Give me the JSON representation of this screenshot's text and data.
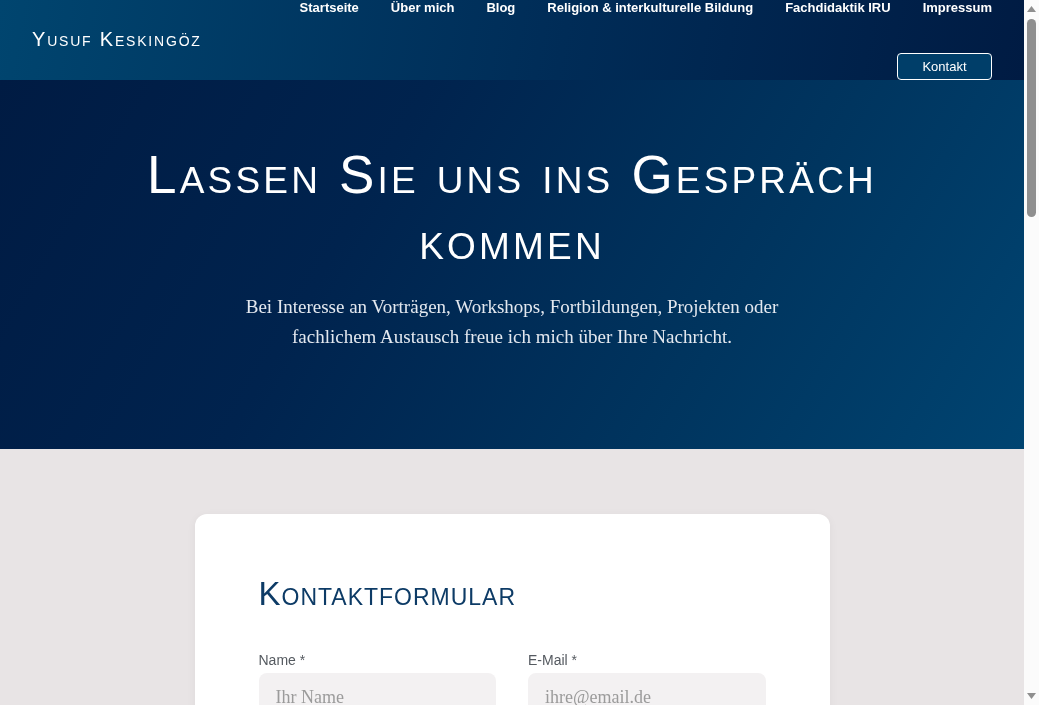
{
  "header": {
    "logo": "Yusuf Keskingöz",
    "nav": [
      {
        "label": "Startseite"
      },
      {
        "label": "Über mich"
      },
      {
        "label": "Blog"
      },
      {
        "label": "Religion & interkulturelle Bildung"
      },
      {
        "label": "Fachdidaktik IRU"
      },
      {
        "label": "Impressum"
      }
    ],
    "cta": "Kontakt"
  },
  "hero": {
    "title": "Lassen Sie uns ins Gespräch kommen",
    "subtitle": "Bei Interesse an Vorträgen, Workshops, Fortbildungen, Projekten oder fachlichem Austausch freue ich mich über Ihre Nachricht."
  },
  "form": {
    "title": "Kontaktformular",
    "fields": [
      {
        "label": "Name *",
        "placeholder": "Ihr Name"
      },
      {
        "label": "E-Mail *",
        "placeholder": "ihre@email.de"
      }
    ]
  }
}
